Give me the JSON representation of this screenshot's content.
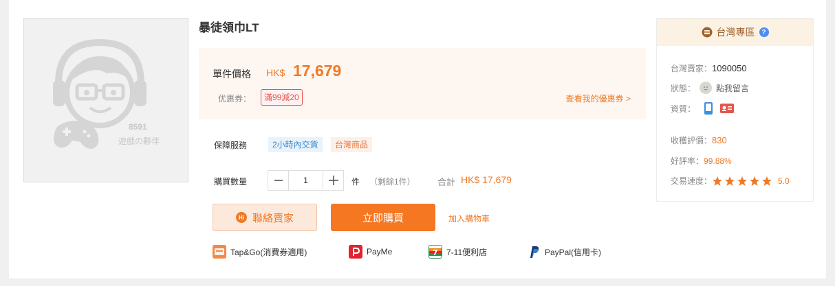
{
  "product": {
    "title": "暴徒領巾LT",
    "image_placeholder_num": "8591",
    "image_placeholder_text": "遊戲の夥伴"
  },
  "price": {
    "label": "單件價格",
    "currency": "HK$",
    "value": "17,679",
    "coupon_label": "优惠券：",
    "coupon_tag": "滿99減20",
    "coupon_link": "查看我的優惠券 >"
  },
  "service": {
    "label": "保障服務",
    "badges": [
      "2小時內交貨",
      "台灣商品"
    ]
  },
  "quantity": {
    "label": "購買數量",
    "value": "1",
    "unit": "件",
    "stock": "（剩餘1件）",
    "total_label": "合計",
    "total_value": "HK$ 17,679"
  },
  "actions": {
    "contact_label": "聯絡賣家",
    "hi_text": "Hi",
    "buy_label": "立即購買",
    "cart_label": "加入購物車"
  },
  "payments": [
    {
      "icon": "tapgo-icon",
      "label": "Tap&Go(消費券適用)"
    },
    {
      "icon": "payme-icon",
      "label": "PayMe"
    },
    {
      "icon": "seven-eleven-icon",
      "label": "7-11便利店"
    },
    {
      "icon": "paypal-icon",
      "label": "PayPal(信用卡)"
    }
  ],
  "seller": {
    "header": "台灣專區",
    "seller_id_label": "台灣賣家：",
    "seller_id": "1090050",
    "status_label": "狀態：",
    "status_value": "點我留言",
    "verify_label": "資質：",
    "rating_count_label": "收穫評價：",
    "rating_count": "830",
    "positive_label": "好評率：",
    "positive_rate": "99.88%",
    "speed_label": "交易速度：",
    "speed_score": "5.0",
    "speed_stars": 5
  },
  "colors": {
    "accent": "#ef7a25",
    "buy_button": "#f57722",
    "coupon_red": "#e8534a",
    "help_blue": "#4a8df0"
  }
}
